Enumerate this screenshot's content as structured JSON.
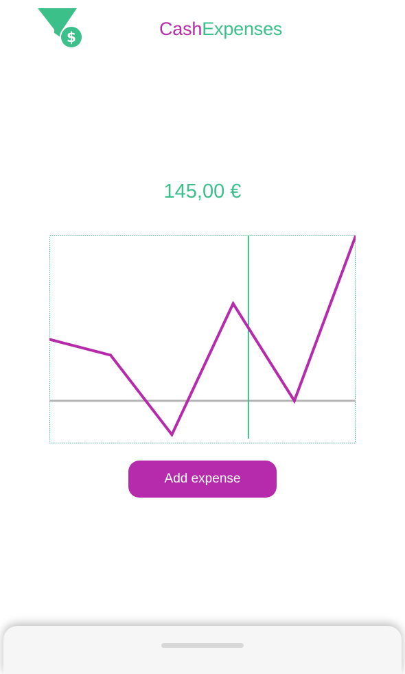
{
  "app": {
    "title_part1": "Cash",
    "title_part2": "Expenses",
    "logo_icon": "funnel-dollar-icon"
  },
  "summary": {
    "amount": "145,00 €"
  },
  "chart_data": {
    "type": "line",
    "x": [
      0,
      1,
      2,
      3,
      4,
      5
    ],
    "series": [
      {
        "values": [
          48,
          40,
          0,
          66,
          17,
          100
        ]
      }
    ],
    "baseline": 17,
    "marker_x": 3.25,
    "ylim": [
      -2,
      100
    ],
    "grid": false,
    "colors": {
      "line": "#b52bab",
      "baseline": "#b5b5b5",
      "marker": "#3cc08a",
      "border": "#3cc08a"
    }
  },
  "actions": {
    "add_expense_label": "Add expense"
  },
  "colors": {
    "brand_purple": "#b52bab",
    "brand_green": "#3cc08a"
  }
}
